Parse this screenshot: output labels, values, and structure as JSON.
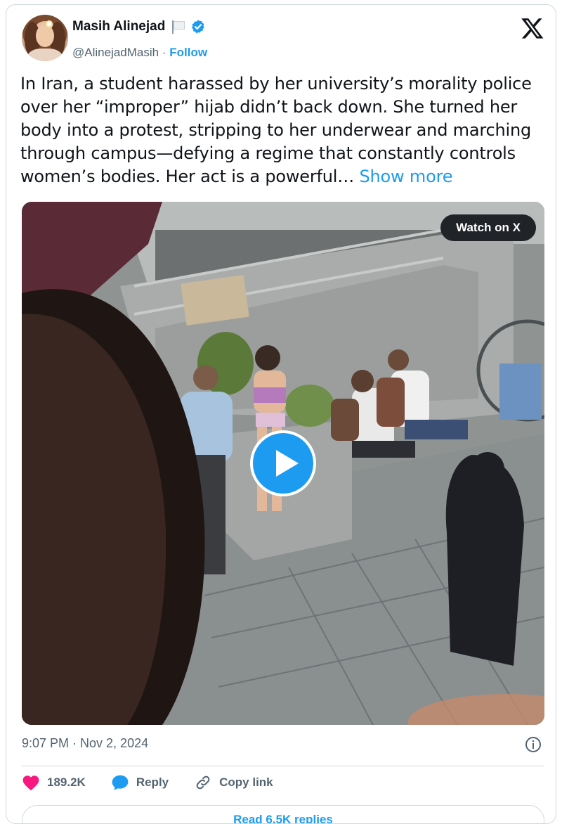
{
  "author": {
    "name": "Masih Alinejad",
    "handle": "@AlinejadMasih",
    "separator": "·",
    "follow_label": "Follow"
  },
  "tweet": {
    "text": "In Iran, a student harassed by her university’s morality police over her “improper” hijab didn’t back down. She turned her body into a protest, stripping to her underwear and marching through campus—defying a regime that constantly controls women’s bodies. Her act is a powerful…",
    "show_more_label": "Show more",
    "timestamp": "9:07 PM · Nov 2, 2024"
  },
  "media": {
    "watch_label": "Watch on X"
  },
  "actions": {
    "likes": "189.2K",
    "reply_label": "Reply",
    "copy_link_label": "Copy link"
  },
  "read_replies_label": "Read 6.5K replies",
  "colors": {
    "accent": "#1d9bf0",
    "like": "#f91880",
    "text": "#0f1419",
    "muted": "#536471"
  },
  "icons": [
    "flag-icon",
    "verified-badge-icon",
    "x-logo-icon",
    "play-icon",
    "info-icon",
    "heart-icon",
    "reply-bubble-icon",
    "link-icon"
  ]
}
